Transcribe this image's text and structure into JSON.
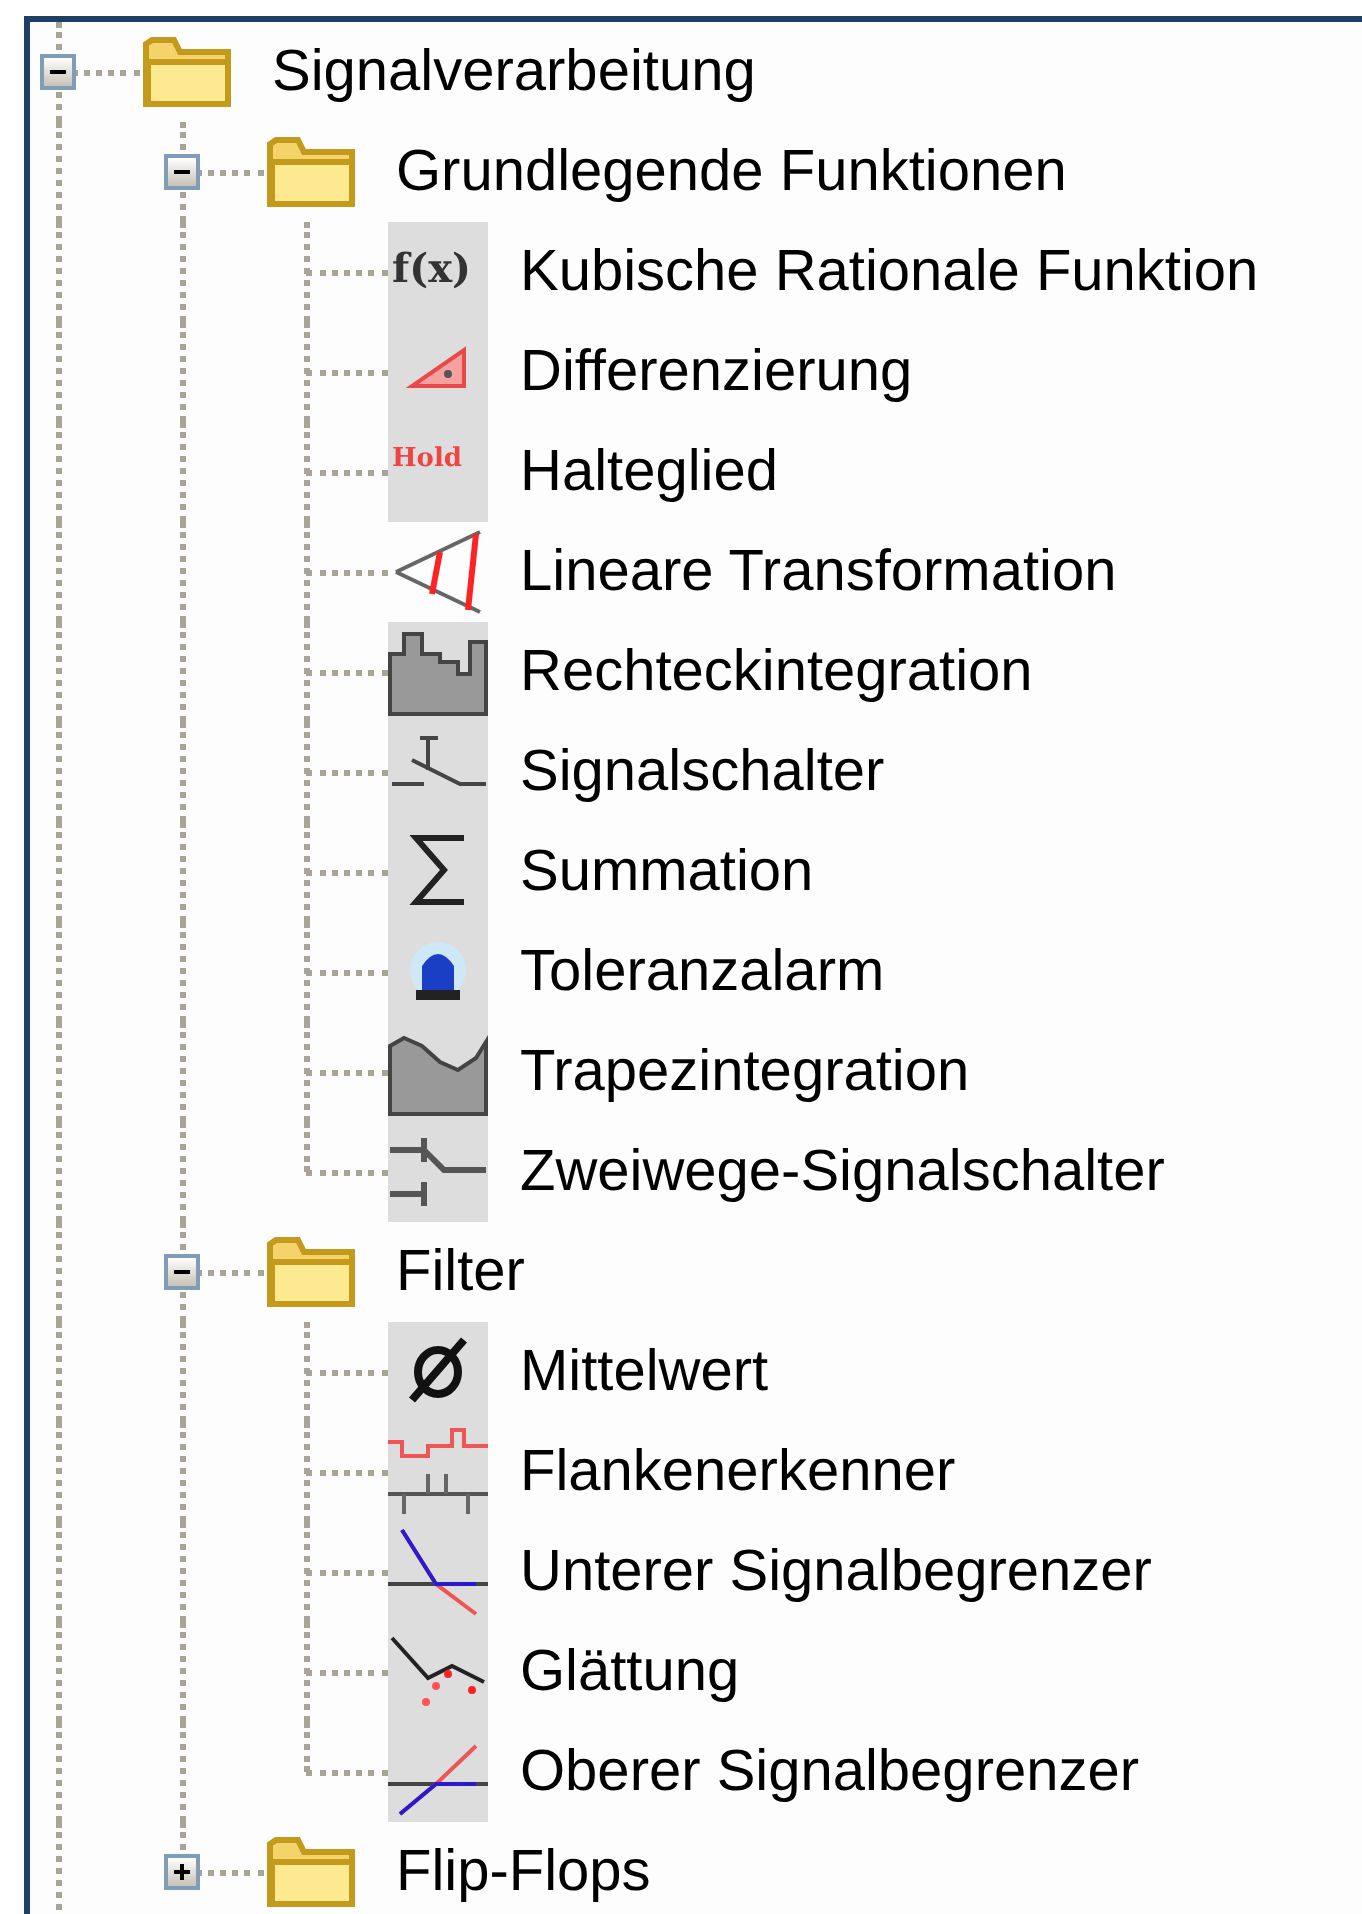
{
  "tree": [
    {
      "label": "Signalverarbeitung",
      "kind": "folder",
      "expanded": true,
      "children": [
        {
          "label": "Grundlegende Funktionen",
          "kind": "folder",
          "expanded": true,
          "children": [
            {
              "label": "Kubische Rationale Funktion",
              "kind": "function",
              "icon_text": "f(x)"
            },
            {
              "label": "Differenzierung",
              "kind": "derivative"
            },
            {
              "label": "Halteglied",
              "kind": "hold",
              "icon_text": "Hold"
            },
            {
              "label": "Lineare Transformation",
              "kind": "transform"
            },
            {
              "label": "Rechteckintegration",
              "kind": "rectangle"
            },
            {
              "label": "Signalschalter",
              "kind": "switch"
            },
            {
              "label": "Summation",
              "kind": "sum"
            },
            {
              "label": "Toleranzalarm",
              "kind": "alarm"
            },
            {
              "label": "Trapezintegration",
              "kind": "trapezoid"
            },
            {
              "label": "Zweiwege-Signalschalter",
              "kind": "twoway"
            }
          ]
        },
        {
          "label": "Filter",
          "kind": "folder",
          "expanded": true,
          "children": [
            {
              "label": "Mittelwert",
              "kind": "mean"
            },
            {
              "label": "Flankenerkenner",
              "kind": "edge"
            },
            {
              "label": "Unterer Signalbegrenzer",
              "kind": "lowerlimit"
            },
            {
              "label": "Glättung",
              "kind": "smoothing"
            },
            {
              "label": "Oberer Signalbegrenzer",
              "kind": "upperlimit"
            }
          ]
        },
        {
          "label": "Flip-Flops",
          "kind": "folder",
          "expanded": false
        }
      ]
    }
  ]
}
